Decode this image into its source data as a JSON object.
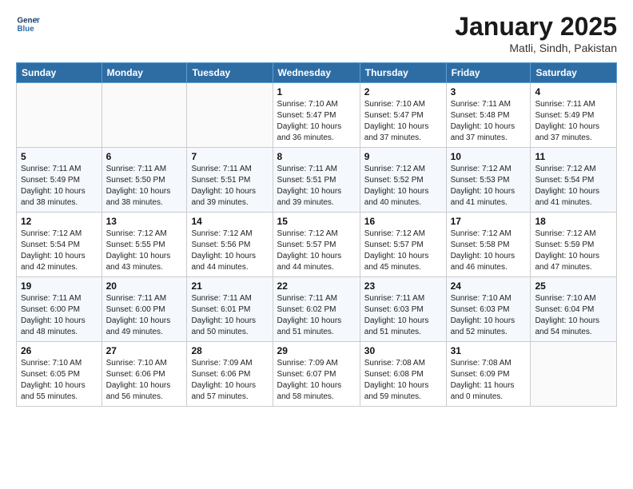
{
  "header": {
    "logo_line1": "General",
    "logo_line2": "Blue",
    "month": "January 2025",
    "location": "Matli, Sindh, Pakistan"
  },
  "weekdays": [
    "Sunday",
    "Monday",
    "Tuesday",
    "Wednesday",
    "Thursday",
    "Friday",
    "Saturday"
  ],
  "weeks": [
    [
      {
        "day": "",
        "info": ""
      },
      {
        "day": "",
        "info": ""
      },
      {
        "day": "",
        "info": ""
      },
      {
        "day": "1",
        "info": "Sunrise: 7:10 AM\nSunset: 5:47 PM\nDaylight: 10 hours\nand 36 minutes."
      },
      {
        "day": "2",
        "info": "Sunrise: 7:10 AM\nSunset: 5:47 PM\nDaylight: 10 hours\nand 37 minutes."
      },
      {
        "day": "3",
        "info": "Sunrise: 7:11 AM\nSunset: 5:48 PM\nDaylight: 10 hours\nand 37 minutes."
      },
      {
        "day": "4",
        "info": "Sunrise: 7:11 AM\nSunset: 5:49 PM\nDaylight: 10 hours\nand 37 minutes."
      }
    ],
    [
      {
        "day": "5",
        "info": "Sunrise: 7:11 AM\nSunset: 5:49 PM\nDaylight: 10 hours\nand 38 minutes."
      },
      {
        "day": "6",
        "info": "Sunrise: 7:11 AM\nSunset: 5:50 PM\nDaylight: 10 hours\nand 38 minutes."
      },
      {
        "day": "7",
        "info": "Sunrise: 7:11 AM\nSunset: 5:51 PM\nDaylight: 10 hours\nand 39 minutes."
      },
      {
        "day": "8",
        "info": "Sunrise: 7:11 AM\nSunset: 5:51 PM\nDaylight: 10 hours\nand 39 minutes."
      },
      {
        "day": "9",
        "info": "Sunrise: 7:12 AM\nSunset: 5:52 PM\nDaylight: 10 hours\nand 40 minutes."
      },
      {
        "day": "10",
        "info": "Sunrise: 7:12 AM\nSunset: 5:53 PM\nDaylight: 10 hours\nand 41 minutes."
      },
      {
        "day": "11",
        "info": "Sunrise: 7:12 AM\nSunset: 5:54 PM\nDaylight: 10 hours\nand 41 minutes."
      }
    ],
    [
      {
        "day": "12",
        "info": "Sunrise: 7:12 AM\nSunset: 5:54 PM\nDaylight: 10 hours\nand 42 minutes."
      },
      {
        "day": "13",
        "info": "Sunrise: 7:12 AM\nSunset: 5:55 PM\nDaylight: 10 hours\nand 43 minutes."
      },
      {
        "day": "14",
        "info": "Sunrise: 7:12 AM\nSunset: 5:56 PM\nDaylight: 10 hours\nand 44 minutes."
      },
      {
        "day": "15",
        "info": "Sunrise: 7:12 AM\nSunset: 5:57 PM\nDaylight: 10 hours\nand 44 minutes."
      },
      {
        "day": "16",
        "info": "Sunrise: 7:12 AM\nSunset: 5:57 PM\nDaylight: 10 hours\nand 45 minutes."
      },
      {
        "day": "17",
        "info": "Sunrise: 7:12 AM\nSunset: 5:58 PM\nDaylight: 10 hours\nand 46 minutes."
      },
      {
        "day": "18",
        "info": "Sunrise: 7:12 AM\nSunset: 5:59 PM\nDaylight: 10 hours\nand 47 minutes."
      }
    ],
    [
      {
        "day": "19",
        "info": "Sunrise: 7:11 AM\nSunset: 6:00 PM\nDaylight: 10 hours\nand 48 minutes."
      },
      {
        "day": "20",
        "info": "Sunrise: 7:11 AM\nSunset: 6:00 PM\nDaylight: 10 hours\nand 49 minutes."
      },
      {
        "day": "21",
        "info": "Sunrise: 7:11 AM\nSunset: 6:01 PM\nDaylight: 10 hours\nand 50 minutes."
      },
      {
        "day": "22",
        "info": "Sunrise: 7:11 AM\nSunset: 6:02 PM\nDaylight: 10 hours\nand 51 minutes."
      },
      {
        "day": "23",
        "info": "Sunrise: 7:11 AM\nSunset: 6:03 PM\nDaylight: 10 hours\nand 51 minutes."
      },
      {
        "day": "24",
        "info": "Sunrise: 7:10 AM\nSunset: 6:03 PM\nDaylight: 10 hours\nand 52 minutes."
      },
      {
        "day": "25",
        "info": "Sunrise: 7:10 AM\nSunset: 6:04 PM\nDaylight: 10 hours\nand 54 minutes."
      }
    ],
    [
      {
        "day": "26",
        "info": "Sunrise: 7:10 AM\nSunset: 6:05 PM\nDaylight: 10 hours\nand 55 minutes."
      },
      {
        "day": "27",
        "info": "Sunrise: 7:10 AM\nSunset: 6:06 PM\nDaylight: 10 hours\nand 56 minutes."
      },
      {
        "day": "28",
        "info": "Sunrise: 7:09 AM\nSunset: 6:06 PM\nDaylight: 10 hours\nand 57 minutes."
      },
      {
        "day": "29",
        "info": "Sunrise: 7:09 AM\nSunset: 6:07 PM\nDaylight: 10 hours\nand 58 minutes."
      },
      {
        "day": "30",
        "info": "Sunrise: 7:08 AM\nSunset: 6:08 PM\nDaylight: 10 hours\nand 59 minutes."
      },
      {
        "day": "31",
        "info": "Sunrise: 7:08 AM\nSunset: 6:09 PM\nDaylight: 11 hours\nand 0 minutes."
      },
      {
        "day": "",
        "info": ""
      }
    ]
  ]
}
